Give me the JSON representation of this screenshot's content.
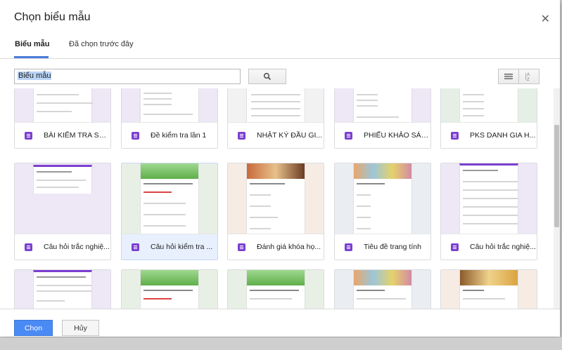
{
  "dialog": {
    "title": "Chọn biểu mẫu",
    "close_icon": "close-icon",
    "tabs": [
      {
        "label": "Biểu mẫu",
        "active": true
      },
      {
        "label": "Đã chọn trước đây",
        "active": false
      }
    ],
    "search": {
      "value": "Biểu mẫu",
      "icon": "search-icon"
    },
    "view_icons": [
      "list-view-icon",
      "sort-az-icon"
    ]
  },
  "cards": [
    {
      "label": "BÀI KIỂM TRA SỐ ...",
      "thumb": "lavender"
    },
    {
      "label": "Đề kiểm tra lần 1",
      "thumb": "lavender"
    },
    {
      "label": "NHẬT KÝ ĐẦU GI...",
      "thumb": "grey"
    },
    {
      "label": "PHIẾU KHẢO SÁT ...",
      "thumb": "lavender"
    },
    {
      "label": "PKS DANH GIA H...",
      "thumb": "green"
    },
    {
      "label": "Câu hỏi trắc nghiệ...",
      "thumb": "lavender"
    },
    {
      "label": "Câu hỏi kiểm tra ...",
      "thumb": "school",
      "selected": true
    },
    {
      "label": "Đánh giá khóa họ...",
      "thumb": "graduation"
    },
    {
      "label": "Tiêu đề trang tính",
      "thumb": "mosaic"
    },
    {
      "label": "Câu hỏi trắc nghiệ...",
      "thumb": "sketch"
    },
    {
      "label": "",
      "thumb": "lavender"
    },
    {
      "label": "",
      "thumb": "school"
    },
    {
      "label": "",
      "thumb": "school"
    },
    {
      "label": "",
      "thumb": "mosaic"
    },
    {
      "label": "",
      "thumb": "books"
    }
  ],
  "footer": {
    "ok_label": "Chọn",
    "cancel_label": "Hủy"
  },
  "colors": {
    "accent": "#4a8af4",
    "form_icon": "#7b3fd0"
  }
}
